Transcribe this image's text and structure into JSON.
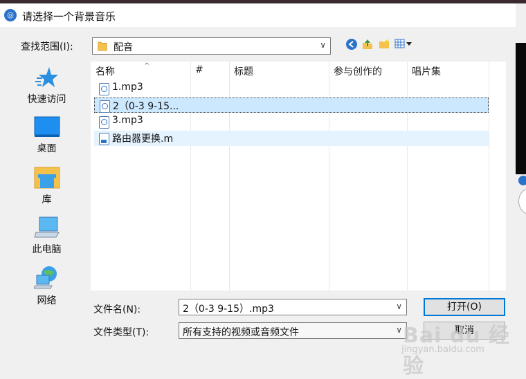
{
  "window": {
    "title": "请选择一个背景音乐"
  },
  "lookin": {
    "label": "查找范围(I):",
    "value": "配音"
  },
  "places": [
    {
      "label": "快速访问",
      "icon": "star-icon"
    },
    {
      "label": "桌面",
      "icon": "desktop-icon"
    },
    {
      "label": "库",
      "icon": "library-icon"
    },
    {
      "label": "此电脑",
      "icon": "computer-icon"
    },
    {
      "label": "网络",
      "icon": "network-icon"
    }
  ],
  "columns": [
    "名称",
    "#",
    "标题",
    "参与创作的",
    "唱片集"
  ],
  "files": [
    {
      "name": "1.mp3",
      "icon": "audio-file-icon"
    },
    {
      "name": "2（0-3  9-15...",
      "icon": "audio-file-icon"
    },
    {
      "name": "3.mp3",
      "icon": "audio-file-icon"
    },
    {
      "name": "路由器更换.m",
      "icon": "document-file-icon"
    }
  ],
  "filename": {
    "label": "文件名(N):",
    "value": "2（0-3  9-15）.mp3"
  },
  "filetype": {
    "label": "文件类型(T):",
    "value": "所有支持的视频或音频文件"
  },
  "buttons": {
    "open": "打开(O)",
    "cancel": "取消"
  },
  "watermark": {
    "main": "Bai du 经验",
    "sub": "jingyan.baidu.com"
  },
  "colors": {
    "selection": "#cce8ff",
    "hover": "#e5f3ff",
    "accent": "#0078d7"
  }
}
